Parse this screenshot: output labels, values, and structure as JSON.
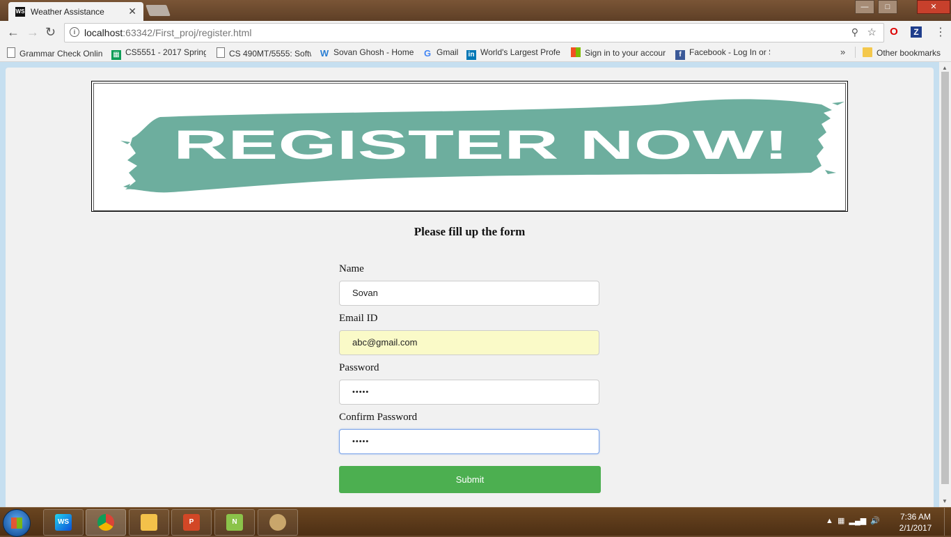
{
  "browser": {
    "tab_title": "Weather Assistance",
    "tab_close": "✕",
    "url_host": "localhost",
    "url_rest": ":63342/First_proj/register.html",
    "bookmarks": [
      {
        "label": "Grammar Check Onlin",
        "icon": "page-icon"
      },
      {
        "label": "CS5551 - 2017 Spring",
        "icon": "sheets-icon"
      },
      {
        "label": "CS 490MT/5555: Softw",
        "icon": "page-icon"
      },
      {
        "label": "Sovan Ghosh - Home",
        "icon": "weebly-icon"
      },
      {
        "label": "Gmail",
        "icon": "google-icon"
      },
      {
        "label": "World's Largest Profe",
        "icon": "linkedin-icon"
      },
      {
        "label": "Sign in to your accour",
        "icon": "microsoft-icon"
      },
      {
        "label": "Facebook - Log In or S",
        "icon": "facebook-icon"
      }
    ],
    "bookmarks_more": "»",
    "other_bookmarks": "Other bookmarks"
  },
  "banner": {
    "text": "REGISTER NOW!",
    "brush_color": "#6dae9e"
  },
  "form": {
    "heading": "Please fill up the form",
    "name_label": "Name",
    "name_value": "Sovan",
    "email_label": "Email ID",
    "email_value": "abc@gmail.com",
    "password_label": "Password",
    "password_value": "•••••",
    "confirm_label": "Confirm Password",
    "confirm_value": "•••••",
    "submit_label": "Submit",
    "submit_color": "#4caf50"
  },
  "taskbar": {
    "time": "7:36 AM",
    "date": "2/1/2017"
  }
}
